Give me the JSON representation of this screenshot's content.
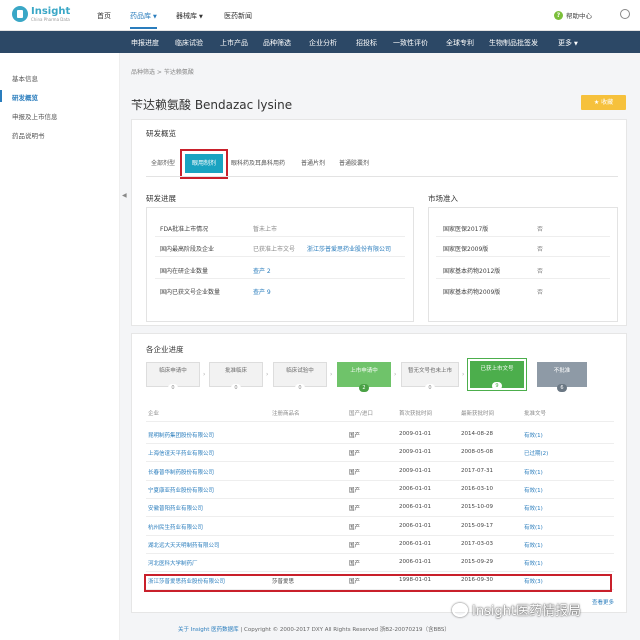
{
  "brand": {
    "name": "Insight",
    "sub": "China Pharma Data"
  },
  "topnav": {
    "items": [
      "首页",
      "药品库",
      "器械库",
      "医药新闻"
    ],
    "help": "帮助中心"
  },
  "bluebar": {
    "items": [
      "申报进度",
      "临床试验",
      "上市产品",
      "品种筛选",
      "企业分析",
      "招投标",
      "一致性评价",
      "全球专利",
      "生物制品批签发",
      "更多"
    ]
  },
  "sidebar": {
    "items": [
      "基本信息",
      "研发概览",
      "申报及上市信息",
      "药品说明书"
    ]
  },
  "breadcrumb": "品种筛选 > 苄达赖氨酸",
  "title": "苄达赖氨酸 Bendazac lysine",
  "fav_label": "收藏",
  "overview": {
    "title": "研发概览",
    "tabs": [
      "全部剂型",
      "眼用制剂",
      "眼科药及耳鼻科用药",
      "普通片剂",
      "普通胶囊剂"
    ],
    "progress": {
      "title": "研发进展",
      "rows": [
        {
          "label": "FDA批准上市情况",
          "value": "暂未上市",
          "link": ""
        },
        {
          "label": "国内最高阶段及企业",
          "value": "已获准上市文号",
          "link": "浙江莎普爱思药业股份有限公司"
        },
        {
          "label": "国内在研企业数量",
          "value": "",
          "link": "查产 2"
        },
        {
          "label": "国内已获文号企业数量",
          "value": "",
          "link": "查产 9"
        }
      ]
    },
    "market": {
      "title": "市场准入",
      "rows": [
        {
          "label": "国家医保2017版",
          "value": "否"
        },
        {
          "label": "国家医保2009版",
          "value": "否"
        },
        {
          "label": "国家基本药物2012版",
          "value": "否"
        },
        {
          "label": "国家基本药物2009版",
          "value": "否"
        }
      ]
    }
  },
  "progress_section": {
    "title": "各企业进度",
    "stages": [
      {
        "label": "临床申请中",
        "count": "0"
      },
      {
        "label": "批准临床",
        "count": "0"
      },
      {
        "label": "临床试验中",
        "count": "0"
      },
      {
        "label": "上市申请中",
        "count": "2"
      },
      {
        "label": "暂无文号也未上市",
        "count": "0"
      },
      {
        "label": "已获上市文号",
        "count": "9"
      },
      {
        "label": "不批准",
        "count": "6"
      }
    ]
  },
  "table": {
    "headers": [
      "企业",
      "注册商品名",
      "国产/进口",
      "首次获批时间",
      "最新获批时间",
      "批准文号"
    ],
    "rows": [
      [
        "昆明制药集团股份有限公司",
        "",
        "国产",
        "2009-01-01",
        "2014-08-28",
        "有效(1)"
      ],
      [
        "上海信谊天平药业有限公司",
        "",
        "国产",
        "2009-01-01",
        "2008-05-08",
        "已过期(2)"
      ],
      [
        "长春普华制药股份有限公司",
        "",
        "国产",
        "2009-01-01",
        "2017-07-31",
        "有效(1)"
      ],
      [
        "宁夏康亚药业股份有限公司",
        "",
        "国产",
        "2006-01-01",
        "2016-03-10",
        "有效(1)"
      ],
      [
        "安徽普阳药业有限公司",
        "",
        "国产",
        "2006-01-01",
        "2015-10-09",
        "有效(1)"
      ],
      [
        "杭州民生药业有限公司",
        "",
        "国产",
        "2006-01-01",
        "2015-09-17",
        "有效(1)"
      ],
      [
        "湖北远大天天明制药有限公司",
        "",
        "国产",
        "2006-01-01",
        "2017-03-03",
        "有效(1)"
      ],
      [
        "河北医科大学制药厂",
        "",
        "国产",
        "2006-01-01",
        "2015-09-29",
        "有效(1)"
      ],
      [
        "浙江莎普爱思药业股份有限公司",
        "莎普爱思",
        "国产",
        "1998-01-01",
        "2016-09-30",
        "有效(3)"
      ]
    ],
    "more": "查看更多"
  },
  "footer": {
    "link": "关于 Insight 医药数据库",
    "text": "| Copyright © 2000-2017 DXY All Rights Reserved 浙B2-20070219（含BBS）"
  },
  "watermark": "Insight医药情报局"
}
